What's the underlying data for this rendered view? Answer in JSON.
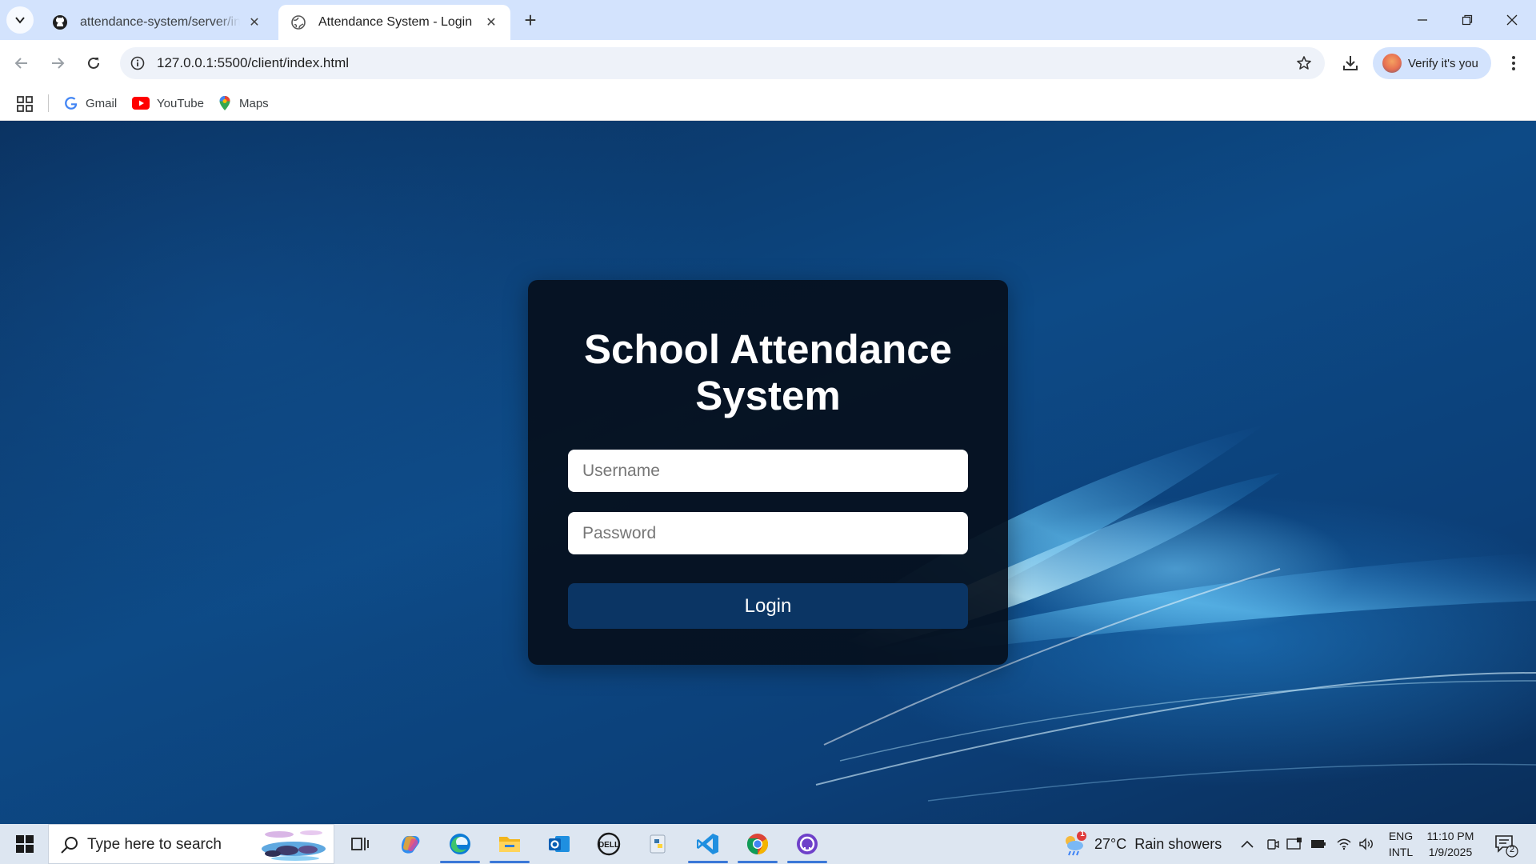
{
  "browser": {
    "tabs": [
      {
        "title": "attendance-system/server/index",
        "active": false,
        "icon": "github-icon"
      },
      {
        "title": "Attendance System - Login",
        "active": true,
        "icon": "globe-icon"
      }
    ],
    "address": {
      "url": "127.0.0.1:5500/client/index.html"
    },
    "profile_label": "Verify it's you",
    "bookmarks": [
      {
        "label": "Gmail",
        "icon": "google-icon"
      },
      {
        "label": "YouTube",
        "icon": "youtube-icon"
      },
      {
        "label": "Maps",
        "icon": "maps-pin-icon"
      }
    ]
  },
  "page": {
    "title": "School Attendance System",
    "username_placeholder": "Username",
    "password_placeholder": "Password",
    "login_label": "Login",
    "colors": {
      "card_bg": "#050f1c",
      "button_bg": "#0b3564",
      "accent": "#0d4a86"
    }
  },
  "taskbar": {
    "search_placeholder": "Type here to search",
    "apps": [
      "task-view-icon",
      "copilot-icon",
      "edge-icon",
      "file-explorer-icon",
      "outlook-icon",
      "dell-icon",
      "python-icon",
      "vscode-icon",
      "chrome-icon",
      "github-desktop-icon"
    ],
    "weather": {
      "temp": "27°C",
      "desc": "Rain showers",
      "badge": "1"
    },
    "lang": {
      "line1": "ENG",
      "line2": "INTL"
    },
    "clock": {
      "time": "11:10 PM",
      "date": "1/9/2025"
    },
    "notifications": "2"
  }
}
